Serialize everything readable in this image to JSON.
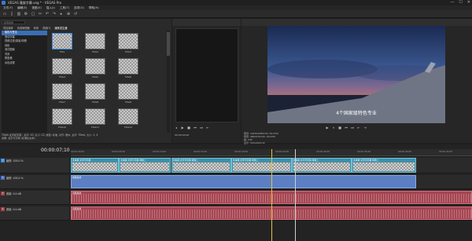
{
  "window": {
    "title": "VEGAS 雅旋字幕.veg * - VEGAS Pro",
    "controls": [
      "—",
      "☐",
      "✕"
    ]
  },
  "menu": [
    "文件(F)",
    "编辑(E)",
    "视图(V)",
    "插入(I)",
    "工具(T)",
    "选项(O)",
    "帮助(H)"
  ],
  "toolbar": {
    "icons": [
      "▭",
      "▯",
      "▥",
      "⚙",
      "▢",
      "✂",
      "↶",
      "↷",
      "▸",
      "⊕",
      "↺"
    ]
  },
  "explorer": {
    "search_placeholder": "搜索媒体",
    "tabs": [
      "项目媒体",
      "资源管理器",
      "转场",
      "视频FX",
      "媒体发生器"
    ],
    "active_tab": 4,
    "list": [
      "版权与签名",
      "滚动字幕",
      "视频过渡(原始)特殊",
      "纯色",
      "测试图案",
      "背景",
      "棋盘格",
      "杂色纹理"
    ],
    "selected_index": 0,
    "thumbs": [
      "Title",
      "Title2",
      "Title3",
      "Title4",
      "Title5",
      "Title6",
      "Title7",
      "Title8",
      "Title9",
      "Title10",
      "Title11",
      "Title12"
    ],
    "selected_thumb": 0,
    "desc_line1": "TitleA 文字和字幕 - 文字: 10, 大小: 12, 类型: 标准, 对齐: 居中, 文字: TitleA, 大小: 1, 4",
    "desc_line2": "说明: 文字与字幕 (标准化文本)"
  },
  "trimmer": {
    "controls": [
      "◂",
      "▶",
      "■",
      "⏮",
      "⏭",
      "⇤"
    ],
    "timecode": "00:00:00;00"
  },
  "preview": {
    "caption": "4个国家级特色专业",
    "controls": [
      "▶",
      "⏸",
      "■",
      "⏮",
      "⏭",
      "⇤",
      "⇥"
    ],
    "info_line1": "项目: 1920x1080x32, 29.970i",
    "info_line2": "预览: 480x270x32, 29.970i",
    "info_line3": "帧: 235",
    "info_line4": "显示: 524x294x32"
  },
  "timeline": {
    "timecode": "00:00:07;10",
    "ruler": [
      "00:00:00;00",
      "00:00:05;00",
      "00:00:10;00",
      "00:00:15;00",
      "00:00:20;00",
      "00:00:25;00",
      "00:00:29;29",
      "00:00:35;00",
      "00:00:40;00",
      "00:00:45;00",
      "00:00:50;00"
    ],
    "tracks": [
      {
        "label": "级别: 100.0 %",
        "number": "1",
        "kind": "video",
        "clips": [
          {
            "label": "文本幕 文字与字幕",
            "start": 0,
            "end": 0.12
          },
          {
            "label": "文本幕 文字与字幕 特效二",
            "start": 0.12,
            "end": 0.25
          },
          {
            "label": "文本幕 文字与字幕 特效二",
            "start": 0.25,
            "end": 0.4
          },
          {
            "label": "文本幕 文字与字幕 特效二",
            "start": 0.4,
            "end": 0.55
          },
          {
            "label": "文本幕 文字与字幕 特效二",
            "start": 0.55,
            "end": 0.7
          },
          {
            "label": "文本幕 文字与字幕 特效二",
            "start": 0.7,
            "end": 0.86
          }
        ]
      },
      {
        "label": "级别: 100.0 %",
        "number": "2",
        "kind": "image",
        "clips": [
          {
            "label": "视频素材",
            "start": 0,
            "end": 0.86
          }
        ]
      },
      {
        "label": "音量: 0.0 dB",
        "number": "3",
        "kind": "audio",
        "clips": [
          {
            "label": "音频素材",
            "start": 0,
            "end": 1
          }
        ]
      },
      {
        "label": "音量: 0.0 dB",
        "number": "4",
        "kind": "audio",
        "clips": [
          {
            "label": "音频素材",
            "start": 0,
            "end": 1
          }
        ]
      }
    ],
    "track_colors": {
      "video": "#3a8bdc",
      "image": "#4a6fc2",
      "audio": "#a8404e"
    }
  }
}
